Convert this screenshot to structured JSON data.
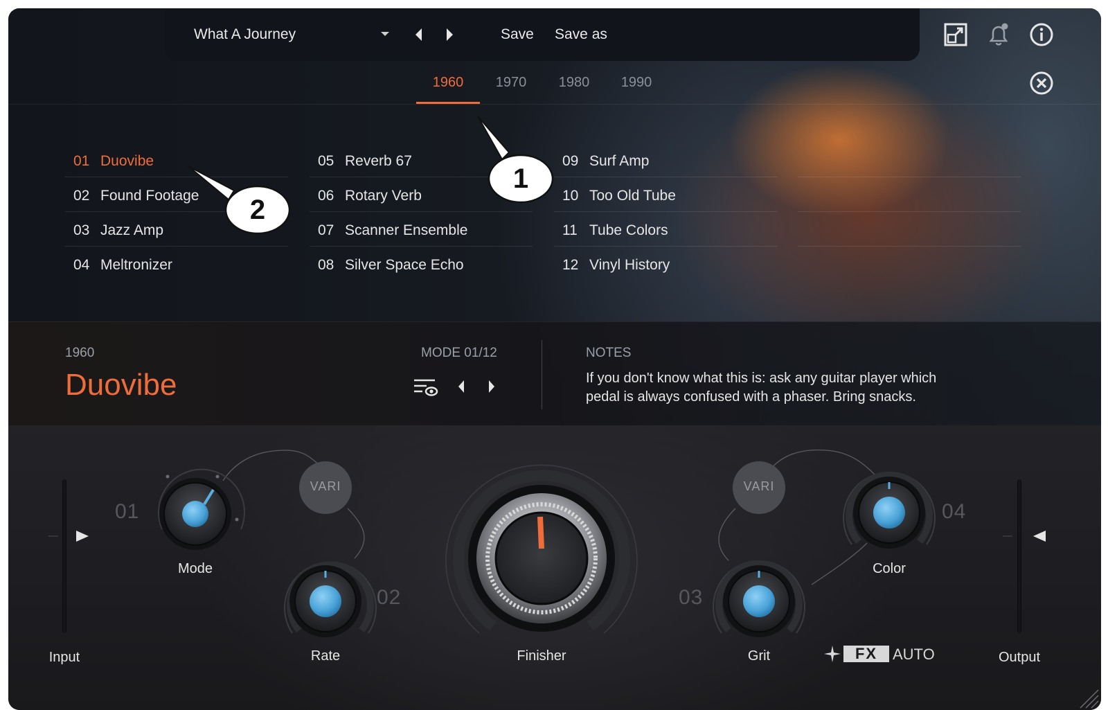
{
  "toolbar": {
    "preset_name": "What A Journey",
    "save_label": "Save",
    "save_as_label": "Save as",
    "icons": [
      "expand-icon",
      "bell-icon",
      "info-icon",
      "close-icon"
    ]
  },
  "eras": {
    "tabs": [
      "1960",
      "1970",
      "1980",
      "1990"
    ],
    "active": "1960"
  },
  "modes": {
    "columns": [
      [
        {
          "num": "01",
          "label": "Duovibe"
        },
        {
          "num": "02",
          "label": "Found Footage"
        },
        {
          "num": "03",
          "label": "Jazz Amp"
        },
        {
          "num": "04",
          "label": "Meltronizer"
        }
      ],
      [
        {
          "num": "05",
          "label": "Reverb 67"
        },
        {
          "num": "06",
          "label": "Rotary Verb"
        },
        {
          "num": "07",
          "label": "Scanner Ensemble"
        },
        {
          "num": "08",
          "label": "Silver Space Echo"
        }
      ],
      [
        {
          "num": "09",
          "label": "Surf Amp"
        },
        {
          "num": "10",
          "label": "Too Old Tube"
        },
        {
          "num": "11",
          "label": "Tube Colors"
        },
        {
          "num": "12",
          "label": "Vinyl History"
        }
      ]
    ],
    "selected": "Duovibe"
  },
  "info": {
    "era": "1960",
    "name": "Duovibe",
    "mode_counter": "MODE 01/12",
    "notes_title": "NOTES",
    "notes_text": "If you don't know what this is: ask any guitar player which pedal is always confused with a phaser. Bring snacks."
  },
  "controls": {
    "input_label": "Input",
    "output_label": "Output",
    "mode_label": "Mode",
    "rate_label": "Rate",
    "finisher_label": "Finisher",
    "grit_label": "Grit",
    "color_label": "Color",
    "vari_label": "VARI",
    "slot_numbers": [
      "01",
      "02",
      "03",
      "04"
    ],
    "logo_text": "FX",
    "logo_suffix": "AUTO",
    "accent_color": "#ef6d3b",
    "knob_color": "#5aaee0"
  },
  "callouts": [
    "1",
    "2"
  ]
}
